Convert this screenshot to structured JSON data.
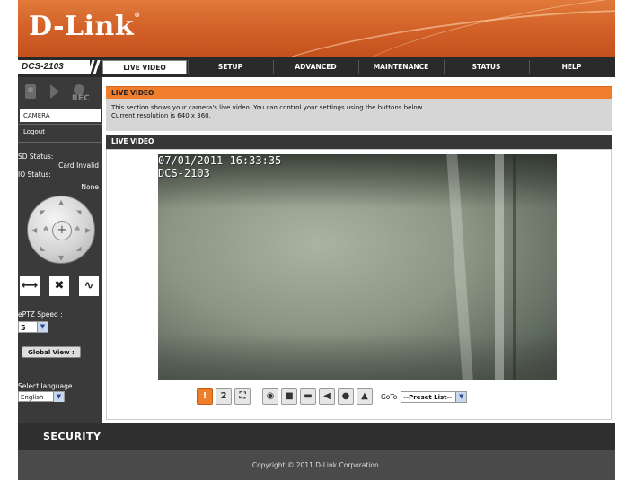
{
  "header": {
    "logo_text": "D-Link",
    "logo_reg": "®"
  },
  "nav": {
    "model": "DCS-2103",
    "tabs": [
      {
        "label": "LIVE VIDEO",
        "active": true
      },
      {
        "label": "SETUP",
        "active": false
      },
      {
        "label": "ADVANCED",
        "active": false
      },
      {
        "label": "MAINTENANCE",
        "active": false
      },
      {
        "label": "STATUS",
        "active": false
      },
      {
        "label": "HELP",
        "active": false
      }
    ]
  },
  "sidebar": {
    "rec_label": "REC",
    "camera_label": "CAMERA",
    "logout_label": "Logout",
    "sd_status_label": "SD Status:",
    "sd_status_value": "Card Invalid",
    "io_status_label": "IO Status:",
    "io_status_value": "None",
    "eptz_speed_label": "ePTZ Speed :",
    "eptz_speed_value": "5",
    "global_view_label": "Global View :",
    "select_language_label": "Select language",
    "language_value": "English"
  },
  "main": {
    "section_title": "LIVE VIDEO",
    "description_line1": "This section shows your camera's live video. You can control your settings using the buttons below.",
    "description_line2": "Current resolution is 640 x 360.",
    "video_title": "LIVE VIDEO",
    "osd_timestamp": "07/01/2011 16:33:35",
    "osd_camera": "DCS-2103",
    "goto_label": "GoTo",
    "preset_value": "--Preset List--"
  },
  "footer": {
    "security_label": "SECURITY",
    "copyright": "Copyright © 2011 D-Link Corporation."
  },
  "colors": {
    "accent": "#f07e2d",
    "dark": "#3a3a3a",
    "header": "#d4632a"
  }
}
